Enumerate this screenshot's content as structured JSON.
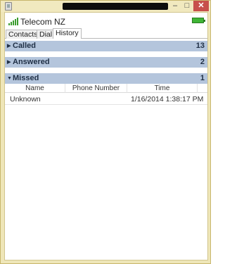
{
  "carrier": "Telecom NZ",
  "window_controls": {
    "minimize": "–",
    "maximize": "□",
    "close": "✕"
  },
  "tabs": [
    {
      "label": "Contacts",
      "selected": false
    },
    {
      "label": "Dial",
      "selected": false
    },
    {
      "label": "History",
      "selected": true
    }
  ],
  "groups": {
    "called": {
      "label": "Called",
      "count": "13",
      "expanded": false
    },
    "answered": {
      "label": "Answered",
      "count": "2",
      "expanded": false
    },
    "missed": {
      "label": "Missed",
      "count": "1",
      "expanded": true
    }
  },
  "arrows": {
    "collapsed": "▶",
    "expanded": "▼"
  },
  "missed_table": {
    "columns": [
      "Name",
      "Phone Number",
      "Time"
    ],
    "rows": [
      {
        "name": "Unknown",
        "phone": "",
        "time": "1/16/2014 1:38:17 PM"
      }
    ]
  },
  "colors": {
    "group_header_bg": "#b4c5dc",
    "signal": "#3a9c2e",
    "battery": "#3fb536",
    "window_frame": "#efe6b8",
    "close_button": "#c7504b"
  },
  "icons": {
    "app": "phone-app-icon",
    "signal": "signal-strength-icon",
    "battery": "battery-icon"
  }
}
